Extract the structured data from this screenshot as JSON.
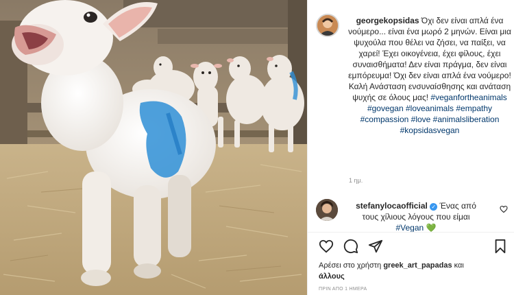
{
  "post": {
    "username": "georgekopsidas",
    "caption_text": " Όχι δεν είναι απλά ένα νούμερο... είναι ένα μωρό 2 μηνών. Είναι μια ψυχούλα που θέλει να ζήσει, να παίξει, να χαρεί! Έχει οικογένεια, έχει φίλους, έχει συναισθήματα! Δεν είναι πράγμα, δεν είναι εμπόρευμα! Όχι δεν είναι απλά ένα νούμερο! Καλή Ανάσταση ενσυναίσθησης και ανάταση ψυχής σε όλους μας! ",
    "hashtags": "#veganfortheanimals #govegan #loveanimals #empathy #compassion #love #animalsliberation #kopsidasvegan",
    "time": "1 ημ."
  },
  "comment": {
    "username": "stefanylocaofficial",
    "verified_mark": "✓",
    "text": " Ένας από τους χίλιους λόγους που είμαι ",
    "tag": "#Vegan",
    "emoji": "💚"
  },
  "likes": {
    "prefix": "Αρέσει στο χρήστη ",
    "user": "greek_art_papadas",
    "middle": " και ",
    "others": "άλλους"
  },
  "timestamp": "ΠΡΙΝ ΑΠΟ 1 ΗΜΕΡΑ",
  "icons": {
    "like": "heart-icon",
    "comment": "comment-icon",
    "share": "paper-plane-icon",
    "save": "bookmark-icon",
    "comment_like": "heart-icon"
  },
  "colors": {
    "link": "#00376b",
    "muted": "#8e8e8e",
    "verified": "#3897f0",
    "dye": "#2f8fd6"
  }
}
